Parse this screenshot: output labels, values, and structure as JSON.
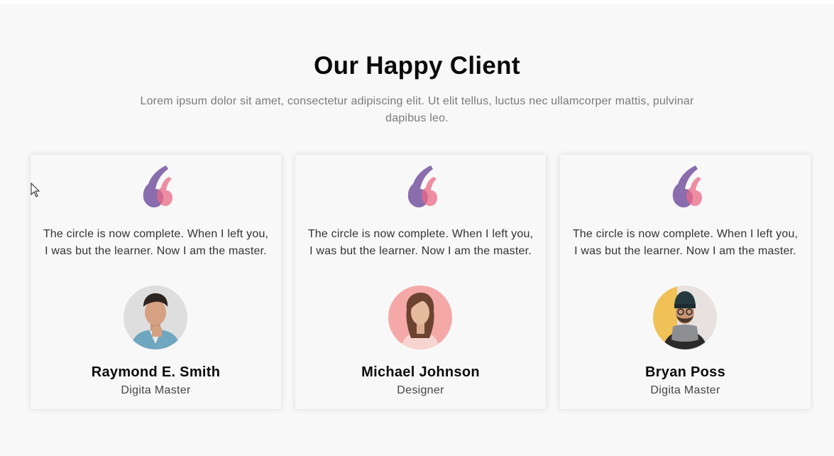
{
  "section": {
    "title": "Our Happy Client",
    "subtitle": "Lorem ipsum dolor sit amet, consectetur adipiscing elit. Ut elit tellus, luctus nec ullamcorper mattis, pulvinar dapibus leo."
  },
  "colors": {
    "quote_purple": "#6e4a9a",
    "quote_pink": "#ea6a86",
    "background": "#f8f8f8"
  },
  "testimonials": [
    {
      "quote_icon": "quote-icon",
      "text": "The circle is now complete. When I left you, I was but the learner. Now I am the master.",
      "name": "Raymond E. Smith",
      "role": "Digita Master"
    },
    {
      "quote_icon": "quote-icon",
      "text": "The circle is now complete. When I left you, I was but the learner. Now I am the master.",
      "name": "Michael Johnson",
      "role": "Designer"
    },
    {
      "quote_icon": "quote-icon",
      "text": "The circle is now complete. When I left you, I was but the learner. Now I am the master.",
      "name": "Bryan Poss",
      "role": "Digita Master"
    }
  ]
}
